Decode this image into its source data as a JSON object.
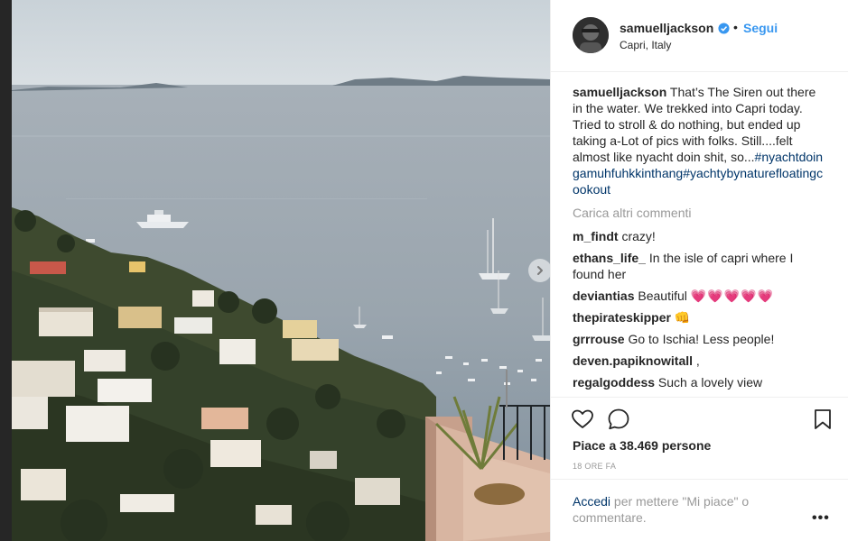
{
  "post": {
    "username": "samuelljackson",
    "follow_separator": "•",
    "follow_label": "Segui",
    "location": "Capri, Italy"
  },
  "caption": {
    "username": "samuelljackson",
    "text": "That’s The Siren out there in the water. We trekked into Capri today. Tried to stroll & do nothing, but ended up taking a-Lot of pics with folks. Still....felt almost like nyacht doin shit, so...",
    "hashtags": "#nyachtdoingamuhfuhkkinthang#yachtybynaturefloatingcookout"
  },
  "load_more_label": "Carica altri commenti",
  "comments": [
    {
      "user": "m_findt",
      "text": "crazy!"
    },
    {
      "user": "ethans_life_",
      "text": "In the isle of capri where I found her"
    },
    {
      "user": "deviantias",
      "text": "Beautiful",
      "emoji": "💗💗💗💗💗"
    },
    {
      "user": "thepirateskipper",
      "text": "",
      "emoji": "👊"
    },
    {
      "user": "grrrouse",
      "text": "Go to Ischia! Less people!"
    },
    {
      "user": "deven.papiknowitall",
      "text": ","
    },
    {
      "user": "regalgoddess",
      "text": "Such a lovely view"
    }
  ],
  "icons": {
    "like": "heart-outline-icon",
    "comment": "speech-bubble-icon",
    "save": "bookmark-icon",
    "next": "chevron-right-icon",
    "more": "ellipsis-icon",
    "verified": "verified-badge-icon"
  },
  "likes_text": "Piace a 38.469 persone",
  "time_ago": "18 ORE FA",
  "login": {
    "link_label": "Accedi",
    "rest_text": " per mettere \"Mi piace\" o commentare."
  },
  "more_label": "•••",
  "colors": {
    "accent": "#3897f0",
    "link": "#003569",
    "muted": "#999999",
    "text": "#262626"
  }
}
